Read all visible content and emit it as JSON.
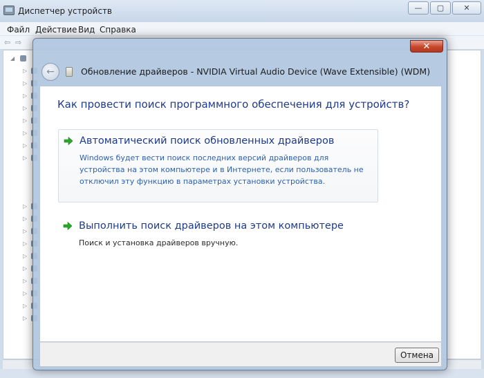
{
  "main_window": {
    "title": "Диспетчер устройств",
    "menu": [
      "Файл",
      "Действие",
      "Вид",
      "Справка"
    ]
  },
  "dialog": {
    "title": "Обновление драйверов - NVIDIA Virtual Audio Device (Wave Extensible) (WDM)",
    "heading": "Как провести поиск программного обеспечения для устройств?",
    "options": [
      {
        "title": "Автоматический поиск обновленных драйверов",
        "description": "Windows будет вести поиск последних версий драйверов для устройства на этом компьютере и в Интернете, если пользователь не отключил эту функцию в параметрах установки устройства."
      },
      {
        "title": "Выполнить поиск драйверов на этом компьютере",
        "description": "Поиск и установка драйверов вручную."
      }
    ],
    "cancel_label": "Отмена"
  },
  "colors": {
    "heading": "#1e3a8a",
    "link_description": "#2b5fb0",
    "arrow": "#2aa82a",
    "close_button": "#c7472b"
  }
}
